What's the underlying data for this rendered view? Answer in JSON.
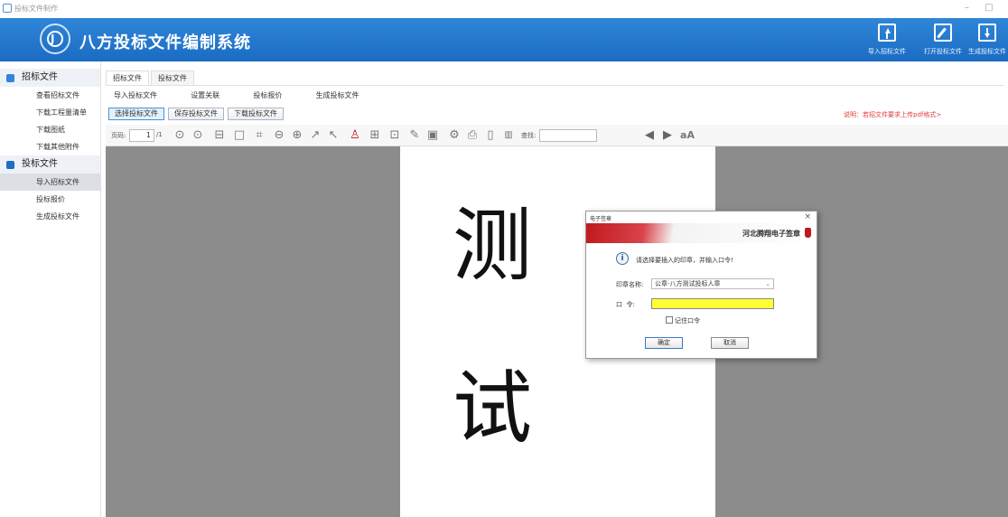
{
  "window": {
    "title": "投标文件制作",
    "controls": {
      "minimize": "–",
      "maximize": "□",
      "close": "×"
    }
  },
  "header": {
    "title": "八方投标文件编制系统",
    "buttons": [
      {
        "label": "导入招标文件",
        "icon": "import-icon"
      },
      {
        "label": "打开投标文件",
        "icon": "edit-icon"
      },
      {
        "label": "生成投标文件",
        "icon": "download-icon"
      }
    ]
  },
  "sidebar": {
    "groups": [
      {
        "label": "招标文件",
        "items": [
          "查看招标文件",
          "下载工程量清单",
          "下载图纸",
          "下载其他附件"
        ]
      },
      {
        "label": "投标文件",
        "items": [
          "导入招标文件",
          "投标报价",
          "生成投标文件"
        ]
      }
    ],
    "active_item": "导入招标文件"
  },
  "tabs": [
    "招标文件",
    "投标文件"
  ],
  "submenu": [
    "导入投标文件",
    "设置关联",
    "投标报价",
    "生成投标文件"
  ],
  "actions": [
    "选择投标文件",
    "保存投标文件",
    "下载投标文件"
  ],
  "note": "说明：若招文件要求上传pdf格式>",
  "pdf_toolbar": {
    "page_label": "页码:",
    "page_value": "1",
    "page_total": "/1",
    "search_label": "查找:",
    "search_value": ""
  },
  "document": {
    "chars": [
      "测",
      "试"
    ]
  },
  "dialog": {
    "title": "电子签章",
    "brand": "河北腾翔电子签章",
    "message": "请选择要插入的印章，并输入口令!",
    "seal_label": "印章名称:",
    "seal_value": "公章-八方测试投标人章",
    "password_label": "口  令:",
    "password_value": "",
    "remember_label": "记住口令",
    "ok_label": "确定",
    "cancel_label": "取消",
    "close": "×"
  }
}
